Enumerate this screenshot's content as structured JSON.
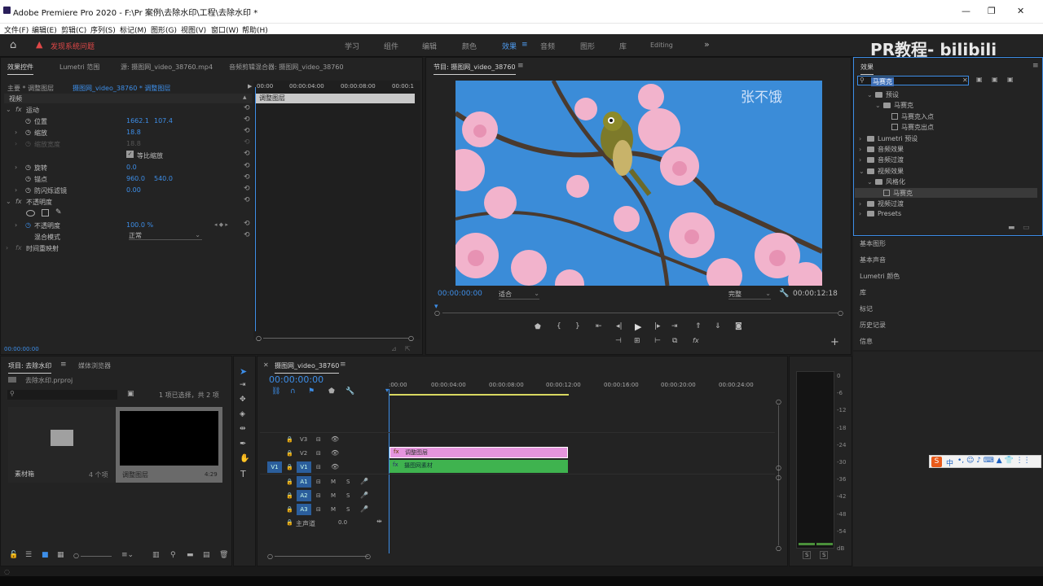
{
  "title": "Adobe Premiere Pro 2020 - F:\\Pr 案例\\去除水印\\工程\\去除水印 *",
  "menu": [
    "文件(F)",
    "编辑(E)",
    "剪辑(C)",
    "序列(S)",
    "标记(M)",
    "图形(G)",
    "视图(V)",
    "窗口(W)",
    "帮助(H)"
  ],
  "alert": "发现系统问题",
  "workspaces": [
    "学习",
    "组件",
    "编辑",
    "颜色",
    "效果",
    "音频",
    "图形",
    "库",
    "Editing"
  ],
  "watermark": "PR教程- bilibili",
  "effectControls": {
    "tabs": [
      "效果控件",
      "Lumetri 范围",
      "源: 摄图网_video_38760.mp4",
      "音频剪辑混合器: 摄图网_video_38760"
    ],
    "master": "主要 * 调整图层",
    "seq": "摄图网_video_38760 * 调整图层",
    "video": "视频",
    "motion": "运动",
    "pos": "位置",
    "posX": "1662.1",
    "posY": "107.4",
    "scale": "缩放",
    "scaleV": "18.8",
    "scaleW": "缩放宽度",
    "scaleWV": "18.8",
    "uniform": "等比缩放",
    "rot": "旋转",
    "rotV": "0.0",
    "anchor": "锚点",
    "anchorX": "960.0",
    "anchorY": "540.0",
    "flicker": "防闪烁滤镜",
    "flickerV": "0.00",
    "opacity": "不透明度",
    "opacityP": "不透明度",
    "opacityV": "100.0 %",
    "blend": "混合模式",
    "blendV": "正常",
    "remap": "时间重映射",
    "tc": "00:00:00:00",
    "ruler": [
      "00:00",
      "00:00:04:00",
      "00:00:08:00",
      "00:00:1"
    ],
    "clip": "调整图层"
  },
  "program": {
    "title": "节目: 摄图网_video_38760",
    "tc": "00:00:00:00",
    "fit": "适合",
    "quality": "完整",
    "dur": "00:00:12:18",
    "wm": "张不饿"
  },
  "effects": {
    "title": "效果",
    "search": "马赛克",
    "tree": [
      {
        "t": "预设",
        "lvl": 1,
        "type": "folder",
        "open": true
      },
      {
        "t": "马赛克",
        "lvl": 2,
        "type": "folder",
        "open": true
      },
      {
        "t": "马赛克入点",
        "lvl": 3,
        "type": "preset"
      },
      {
        "t": "马赛克出点",
        "lvl": 3,
        "type": "preset"
      },
      {
        "t": "Lumetri 预设",
        "lvl": 0,
        "type": "folder"
      },
      {
        "t": "音频效果",
        "lvl": 0,
        "type": "folder"
      },
      {
        "t": "音频过渡",
        "lvl": 0,
        "type": "folder"
      },
      {
        "t": "视频效果",
        "lvl": 0,
        "type": "folder",
        "open": true
      },
      {
        "t": "风格化",
        "lvl": 1,
        "type": "folder",
        "open": true
      },
      {
        "t": "马赛克",
        "lvl": 2,
        "type": "effect",
        "sel": true
      },
      {
        "t": "视频过渡",
        "lvl": 0,
        "type": "folder"
      },
      {
        "t": "Presets",
        "lvl": 0,
        "type": "folder"
      }
    ],
    "sections": [
      "基本图形",
      "基本声音",
      "Lumetri 颜色",
      "库",
      "标记",
      "历史记录",
      "信息"
    ]
  },
  "project": {
    "tabs": [
      "项目: 去除水印",
      "媒体浏览器"
    ],
    "file": "去除水印.prproj",
    "count": "1 项已选择，共 2 项",
    "bin": "素材箱",
    "binCount": "4 个项",
    "clip": "调整图层",
    "clipDur": "4:29"
  },
  "timeline": {
    "tab": "摄图网_video_38760",
    "tc": "00:00:00:00",
    "ruler": [
      ":00:00",
      "00:00:04:00",
      "00:00:08:00",
      "00:00:12:00",
      "00:00:16:00",
      "00:00:20:00",
      "00:00:24:00"
    ],
    "tracks": [
      "V3",
      "V2",
      "V1",
      "A1",
      "A2",
      "A3"
    ],
    "master": "主声道",
    "masterV": "0.0",
    "clipA": "调整图层",
    "clipB": "摄图网素材"
  },
  "meter": [
    "0",
    "-6",
    "-12",
    "-18",
    "-24",
    "-30",
    "-36",
    "-42",
    "-48",
    "-54",
    "dB"
  ],
  "meterBtns": [
    "S",
    "S"
  ],
  "ime": "中"
}
